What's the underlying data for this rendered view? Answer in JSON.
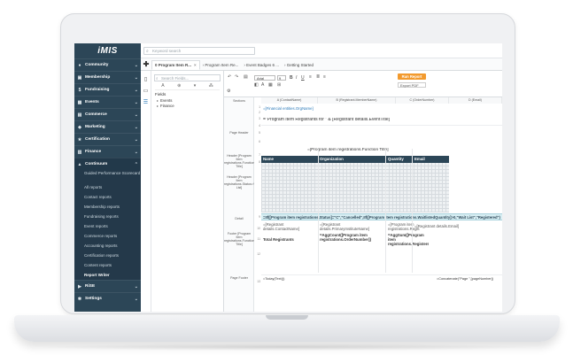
{
  "sidebar": {
    "logo": "iMIS",
    "items": [
      {
        "label": "Community",
        "icon": "people-icon"
      },
      {
        "label": "Membership",
        "icon": "membership-icon"
      },
      {
        "label": "Fundraising",
        "icon": "fundraising-icon"
      },
      {
        "label": "Events",
        "icon": "calendar-icon"
      },
      {
        "label": "Commerce",
        "icon": "cart-icon"
      },
      {
        "label": "Marketing",
        "icon": "megaphone-icon"
      },
      {
        "label": "Certification",
        "icon": "certificate-icon"
      },
      {
        "label": "Finance",
        "icon": "finance-icon"
      },
      {
        "label": "Continuum",
        "icon": "continuum-icon"
      }
    ],
    "continuum_subitems": [
      "Guided Performance Scorecard",
      "All reports",
      "Contact reports",
      "Membership reports",
      "Fundraising reports",
      "Event reports",
      "Commerce reports",
      "Accounting reports",
      "Certification reports",
      "Content reports",
      "Report Writer"
    ],
    "bottom_items": [
      {
        "label": "RiSE",
        "icon": "rise-icon"
      },
      {
        "label": "Settings",
        "icon": "gear-icon"
      }
    ]
  },
  "search": {
    "placeholder": "Keyword search"
  },
  "tabs": [
    {
      "label": "0 Program Item R...",
      "active": true
    },
    {
      "label": "Program Item Re...",
      "active": false
    },
    {
      "label": "Event Badges 6 ...",
      "active": false
    },
    {
      "label": "Getting Started",
      "active": false
    }
  ],
  "fields_panel": {
    "search_placeholder": "Search Fields...",
    "heading": "Fields",
    "nodes": [
      "Events",
      "Finance"
    ]
  },
  "toolbar": {
    "font": "Arial",
    "size": "9",
    "run_label": "Run Report",
    "export_label": "Export PDF"
  },
  "columns": [
    "A (ContactName)",
    "B (Registrant.MemberName)",
    "C (OrderNumber)",
    "D (Email)"
  ],
  "bands": {
    "sections": "Sections",
    "page_header": "Page Header",
    "header1": "Header [Program Item registrations.Function Title]",
    "header2": "Header [Program Item registrations.Status='Cancelled' List]",
    "detail": "Detail",
    "footer": "Footer [Program Item registrations.Function Title]",
    "page_footer": "Page Footer"
  },
  "line_numbers": [
    "1",
    "2",
    "3",
    "4",
    "5",
    "6",
    "7",
    "8",
    "9",
    "10",
    "11",
    "12",
    "13",
    "14",
    "15",
    "16",
    "17",
    "18"
  ],
  "cells": {
    "org_name": "=[Financial entities.OrgName]",
    "report_title": "=\"Program Item Registrants for \" & [Registrant details.EventTitle]",
    "function_title": "=[Program item registrations.Function Title]",
    "hdr_name": "Name",
    "hdr_org": "Organization",
    "hdr_qty": "Quantity",
    "hdr_email": "Email",
    "formula_row": "=IIf([Program item registrations.Status]=\"C\",\"Cancelled\",IIf([Program item registrations.WaitlistedQuantity]>0,\"Wait List\",\"Registered\")",
    "detail_name": "=[Registrant details.ContactName]",
    "detail_org": "=[Registrant details.PrimaryInstituteName]",
    "detail_qty": "=[Program item registrations.Regis",
    "detail_email": "=[Registrant details.Email]",
    "footer_label": "Total Registrants",
    "footer_count": "=AggCount([Program item registrations.OrderNumber])",
    "footer_sum": "=AggSum([Program item registrations.RegisteredQuantity])",
    "page_footer_left": "=Today(Text())",
    "page_footer_right": "=Concatenate(\"Page \",[pageNumber])"
  }
}
